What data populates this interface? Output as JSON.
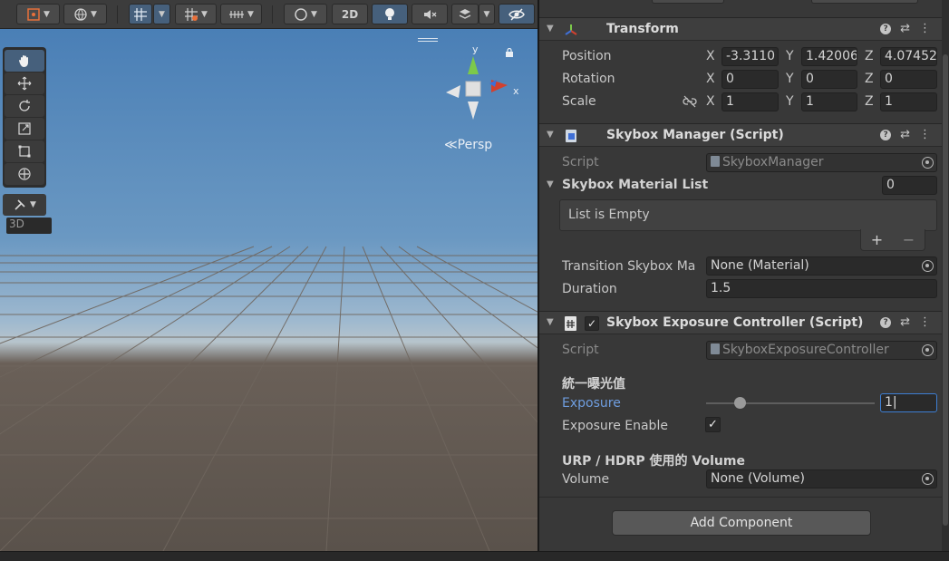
{
  "scene_toolbar": {
    "btn_2d_label": "2D"
  },
  "viewport": {
    "persp_label": "Persp",
    "gizmo_x": "x",
    "gizmo_y": "y",
    "badge_3d": "3D"
  },
  "inspector": {
    "transform": {
      "title": "Transform",
      "position_label": "Position",
      "rotation_label": "Rotation",
      "scale_label": "Scale",
      "axis_x": "X",
      "axis_y": "Y",
      "axis_z": "Z",
      "position": {
        "x": "-3.3110",
        "y": "1.42006",
        "z": "4.07452"
      },
      "rotation": {
        "x": "0",
        "y": "0",
        "z": "0"
      },
      "scale": {
        "x": "1",
        "y": "1",
        "z": "1"
      }
    },
    "skybox_manager": {
      "title": "Skybox Manager (Script)",
      "script_label": "Script",
      "script_value": "SkyboxManager",
      "list_label": "Skybox Material List",
      "list_count": "0",
      "list_empty": "List is Empty",
      "list_add": "+",
      "list_remove": "−",
      "transition_label": "Transition Skybox Ma",
      "transition_value": "None (Material)",
      "duration_label": "Duration",
      "duration_value": "1.5"
    },
    "skybox_exposure": {
      "title": "Skybox Exposure Controller (Script)",
      "script_label": "Script",
      "script_value": "SkyboxExposureController",
      "section_header": "統一曝光值",
      "exposure_label": "Exposure",
      "exposure_value": "1",
      "exposure_slider_fraction": 0.2,
      "exposure_enable_label": "Exposure Enable",
      "exposure_enable_checked": true,
      "volume_header": "URP / HDRP 使用的 Volume",
      "volume_label": "Volume",
      "volume_value": "None (Volume)"
    },
    "add_component_label": "Add Component"
  },
  "colors": {
    "accent_blue": "#46607c",
    "exposure_label_blue": "#6f9ee0",
    "gizmo_x_red": "#d2402e",
    "gizmo_y_green": "#7cc94a",
    "gizmo_z_blue": "#3f6fd6"
  }
}
